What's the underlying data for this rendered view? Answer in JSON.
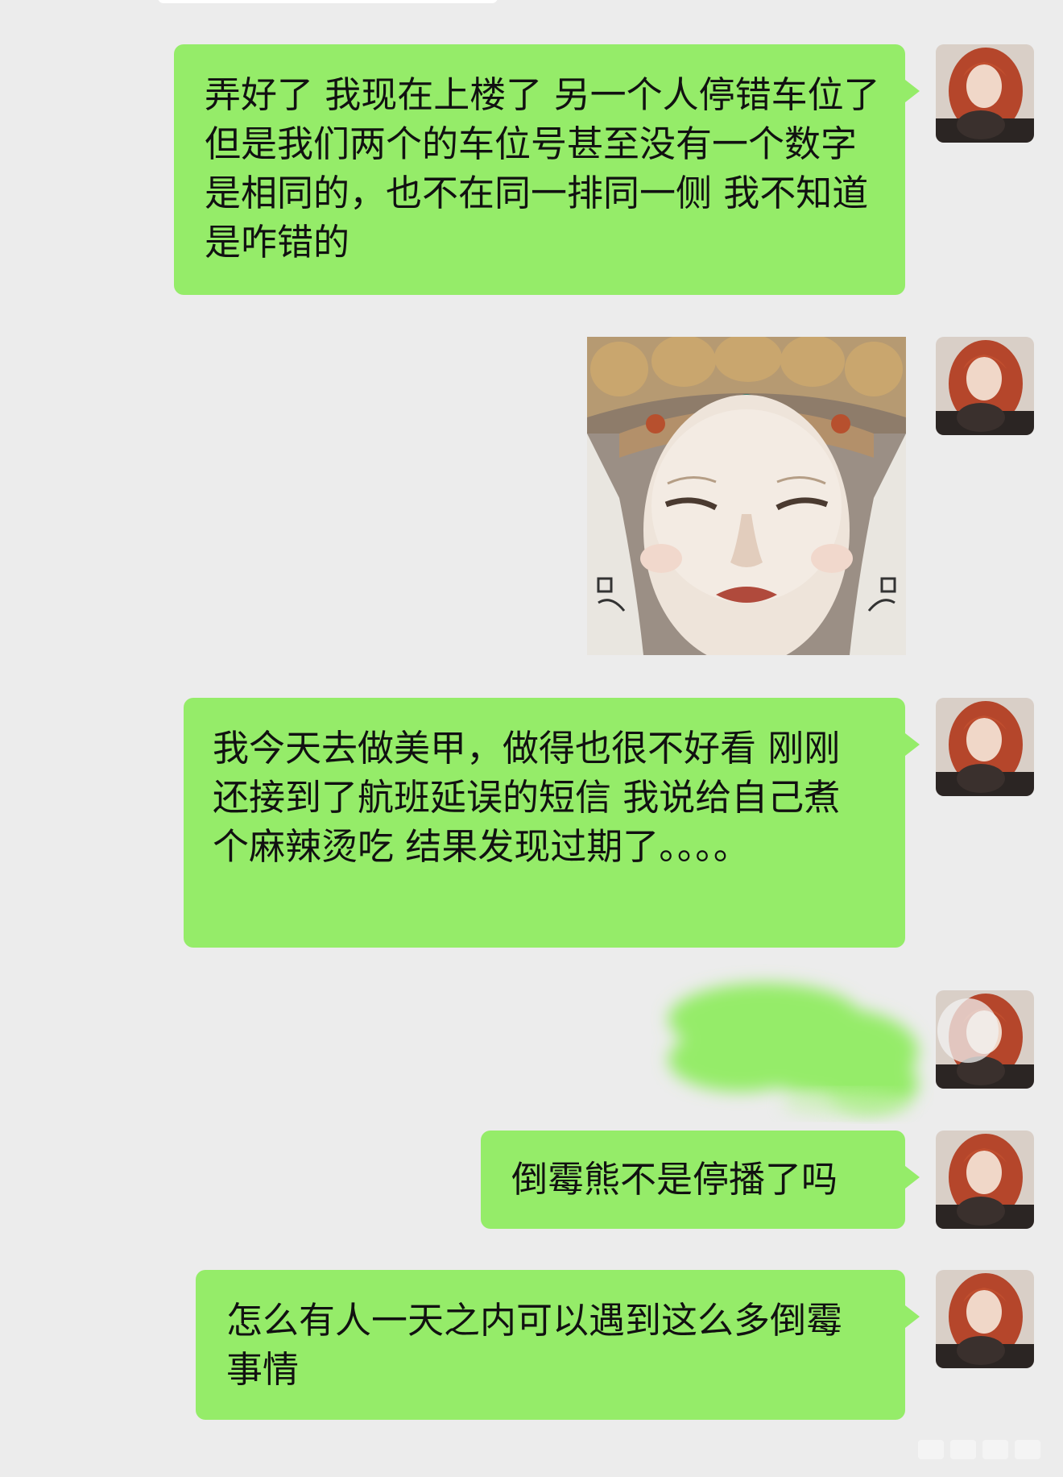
{
  "chat": {
    "messages": [
      {
        "type": "text",
        "text": "弄好了 我现在上楼了 另一个人停错车位了 但是我们两个的车位号甚至没有一个数字是相同的，也不在同一排同一侧 我不知道是咋错的"
      },
      {
        "type": "image",
        "alt": ""
      },
      {
        "type": "text",
        "text": "我今天去做美甲，做得也很不好看 刚刚还接到了航班延误的短信 我说给自己煮个麻辣烫吃 结果发现过期了。。。。"
      },
      {
        "type": "redacted"
      },
      {
        "type": "text",
        "text": "倒霉熊不是停播了吗"
      },
      {
        "type": "text",
        "text": "怎么有人一天之内可以遇到这么多倒霉事情"
      }
    ]
  },
  "colors": {
    "background": "#ececec",
    "bubble": "#95ec69",
    "text": "#111111"
  },
  "icons": {
    "avatar": "user-avatar-photo",
    "sticker": "statue-face-sticker"
  }
}
